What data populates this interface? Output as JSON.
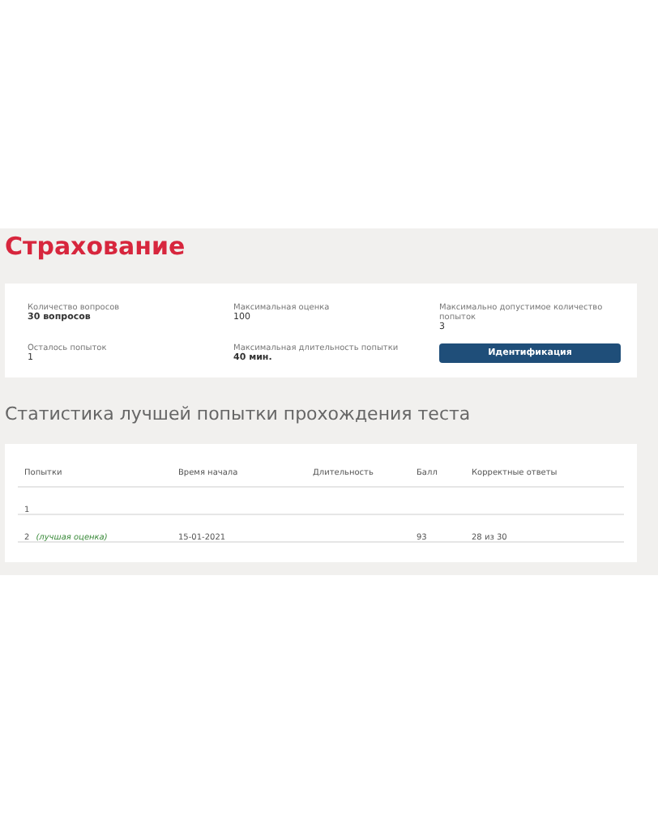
{
  "title": "Страхование",
  "info": [
    {
      "label": "Количество вопросов",
      "value": "30 вопросов"
    },
    {
      "label": "Максимальная оценка",
      "value": "100"
    },
    {
      "label": "Максимально допустимое количество попыток",
      "value": "3"
    },
    {
      "label": "Осталось попыток",
      "value": "1"
    },
    {
      "label": "Максимальная длительность попытки",
      "value": "40 мин."
    }
  ],
  "identify_button": "Идентификация",
  "stats_heading": "Статистика лучшей попытки прохождения теста",
  "table": {
    "columns": [
      "Попытки",
      "Время начала",
      "Длительность",
      "Балл",
      "Корректные ответы"
    ],
    "rows": [
      {
        "cells": [
          "1",
          "",
          "",
          "",
          ""
        ],
        "note": ""
      },
      {
        "cells": [
          "2",
          "15-01-2021",
          "",
          "93",
          "28 из 30"
        ],
        "note": "(лучшая оценка)"
      }
    ]
  }
}
